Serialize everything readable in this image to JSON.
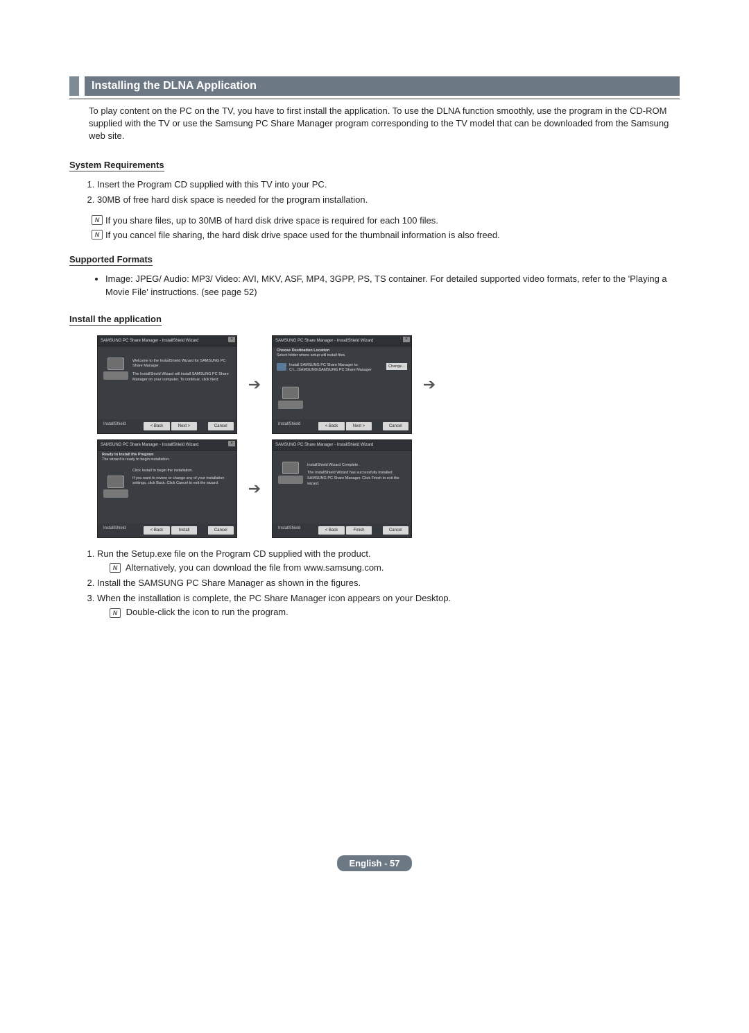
{
  "section_title": "Installing the DLNA Application",
  "intro": "To play content on the PC on the TV, you have to first install the application. To use the DLNA function smoothly, use the program in the CD-ROM supplied with the TV or use the Samsung PC Share Manager program corresponding to the TV model that can be downloaded from the Samsung web site.",
  "sub1": {
    "heading": "System Requirements",
    "items": [
      "Insert the Program CD supplied with this TV into your PC.",
      "30MB of free hard disk space is needed for the program  installation."
    ],
    "notes": [
      "If you share files, up to 30MB of hard disk drive space is required for each 100 files.",
      "If you cancel file sharing, the hard disk drive space used for the thumbnail information is also freed."
    ]
  },
  "sub2": {
    "heading": "Supported Formats",
    "bullet": "Image: JPEG/ Audio: MP3/ Video: AVI, MKV, ASF, MP4, 3GPP, PS, TS container. For detailed supported video formats, refer to the 'Playing a Movie File' instructions. (see page 52)"
  },
  "sub3": {
    "heading": "Install the application",
    "steps": [
      "Run the Setup.exe file on the Program CD supplied with the product.",
      "Install the SAMSUNG PC Share Manager as shown in the figures.",
      "When the installation is complete, the PC Share Manager icon appears on your Desktop."
    ],
    "step1_note": "Alternatively, you can download the file from www.samsung.com.",
    "step3_note": "Double-click the icon to run the program."
  },
  "wizard": {
    "title": "SAMSUNG PC Share Manager - InstallShield Wizard",
    "w1": {
      "heading": "Welcome to the InstallShield Wizard for SAMSUNG PC Share Manager.",
      "body": "The InstallShield Wizard will install SAMSUNG PC Share Manager on your computer. To continue, click Next."
    },
    "w2": {
      "sub1": "Choose Destination Location",
      "sub2": "Select folder where setup will install files.",
      "path1": "Install SAMSUNG PC Share Manager to:",
      "path2": "C:\\...\\SAMSUNG\\SAMSUNG PC Share Manager",
      "change": "Change..."
    },
    "w3": {
      "sub1": "Ready to Install the Program",
      "sub2": "The wizard is ready to begin installation.",
      "body1": "Click Install to begin the installation.",
      "body2": "If you want to review or change any of your installation settings, click Back. Click Cancel to exit the wizard."
    },
    "w4": {
      "heading": "InstallShield Wizard Complete",
      "body": "The InstallShield Wizard has successfully installed SAMSUNG PC Share Manager. Click Finish to exit the wizard."
    },
    "btns": {
      "back": "< Back",
      "next": "Next >",
      "install": "Install",
      "finish": "Finish",
      "cancel": "Cancel",
      "shield": "InstallShield"
    }
  },
  "note_glyph": "N",
  "footer": "English - 57"
}
